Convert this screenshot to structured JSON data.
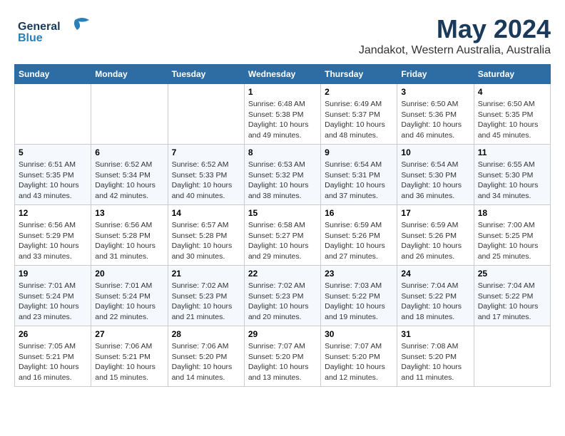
{
  "header": {
    "logo_line1": "General",
    "logo_line2": "Blue",
    "month_title": "May 2024",
    "location": "Jandakot, Western Australia, Australia"
  },
  "weekdays": [
    "Sunday",
    "Monday",
    "Tuesday",
    "Wednesday",
    "Thursday",
    "Friday",
    "Saturday"
  ],
  "weeks": [
    [
      {
        "day": "",
        "info": ""
      },
      {
        "day": "",
        "info": ""
      },
      {
        "day": "",
        "info": ""
      },
      {
        "day": "1",
        "info": "Sunrise: 6:48 AM\nSunset: 5:38 PM\nDaylight: 10 hours\nand 49 minutes."
      },
      {
        "day": "2",
        "info": "Sunrise: 6:49 AM\nSunset: 5:37 PM\nDaylight: 10 hours\nand 48 minutes."
      },
      {
        "day": "3",
        "info": "Sunrise: 6:50 AM\nSunset: 5:36 PM\nDaylight: 10 hours\nand 46 minutes."
      },
      {
        "day": "4",
        "info": "Sunrise: 6:50 AM\nSunset: 5:35 PM\nDaylight: 10 hours\nand 45 minutes."
      }
    ],
    [
      {
        "day": "5",
        "info": "Sunrise: 6:51 AM\nSunset: 5:35 PM\nDaylight: 10 hours\nand 43 minutes."
      },
      {
        "day": "6",
        "info": "Sunrise: 6:52 AM\nSunset: 5:34 PM\nDaylight: 10 hours\nand 42 minutes."
      },
      {
        "day": "7",
        "info": "Sunrise: 6:52 AM\nSunset: 5:33 PM\nDaylight: 10 hours\nand 40 minutes."
      },
      {
        "day": "8",
        "info": "Sunrise: 6:53 AM\nSunset: 5:32 PM\nDaylight: 10 hours\nand 38 minutes."
      },
      {
        "day": "9",
        "info": "Sunrise: 6:54 AM\nSunset: 5:31 PM\nDaylight: 10 hours\nand 37 minutes."
      },
      {
        "day": "10",
        "info": "Sunrise: 6:54 AM\nSunset: 5:30 PM\nDaylight: 10 hours\nand 36 minutes."
      },
      {
        "day": "11",
        "info": "Sunrise: 6:55 AM\nSunset: 5:30 PM\nDaylight: 10 hours\nand 34 minutes."
      }
    ],
    [
      {
        "day": "12",
        "info": "Sunrise: 6:56 AM\nSunset: 5:29 PM\nDaylight: 10 hours\nand 33 minutes."
      },
      {
        "day": "13",
        "info": "Sunrise: 6:56 AM\nSunset: 5:28 PM\nDaylight: 10 hours\nand 31 minutes."
      },
      {
        "day": "14",
        "info": "Sunrise: 6:57 AM\nSunset: 5:28 PM\nDaylight: 10 hours\nand 30 minutes."
      },
      {
        "day": "15",
        "info": "Sunrise: 6:58 AM\nSunset: 5:27 PM\nDaylight: 10 hours\nand 29 minutes."
      },
      {
        "day": "16",
        "info": "Sunrise: 6:59 AM\nSunset: 5:26 PM\nDaylight: 10 hours\nand 27 minutes."
      },
      {
        "day": "17",
        "info": "Sunrise: 6:59 AM\nSunset: 5:26 PM\nDaylight: 10 hours\nand 26 minutes."
      },
      {
        "day": "18",
        "info": "Sunrise: 7:00 AM\nSunset: 5:25 PM\nDaylight: 10 hours\nand 25 minutes."
      }
    ],
    [
      {
        "day": "19",
        "info": "Sunrise: 7:01 AM\nSunset: 5:24 PM\nDaylight: 10 hours\nand 23 minutes."
      },
      {
        "day": "20",
        "info": "Sunrise: 7:01 AM\nSunset: 5:24 PM\nDaylight: 10 hours\nand 22 minutes."
      },
      {
        "day": "21",
        "info": "Sunrise: 7:02 AM\nSunset: 5:23 PM\nDaylight: 10 hours\nand 21 minutes."
      },
      {
        "day": "22",
        "info": "Sunrise: 7:02 AM\nSunset: 5:23 PM\nDaylight: 10 hours\nand 20 minutes."
      },
      {
        "day": "23",
        "info": "Sunrise: 7:03 AM\nSunset: 5:22 PM\nDaylight: 10 hours\nand 19 minutes."
      },
      {
        "day": "24",
        "info": "Sunrise: 7:04 AM\nSunset: 5:22 PM\nDaylight: 10 hours\nand 18 minutes."
      },
      {
        "day": "25",
        "info": "Sunrise: 7:04 AM\nSunset: 5:22 PM\nDaylight: 10 hours\nand 17 minutes."
      }
    ],
    [
      {
        "day": "26",
        "info": "Sunrise: 7:05 AM\nSunset: 5:21 PM\nDaylight: 10 hours\nand 16 minutes."
      },
      {
        "day": "27",
        "info": "Sunrise: 7:06 AM\nSunset: 5:21 PM\nDaylight: 10 hours\nand 15 minutes."
      },
      {
        "day": "28",
        "info": "Sunrise: 7:06 AM\nSunset: 5:20 PM\nDaylight: 10 hours\nand 14 minutes."
      },
      {
        "day": "29",
        "info": "Sunrise: 7:07 AM\nSunset: 5:20 PM\nDaylight: 10 hours\nand 13 minutes."
      },
      {
        "day": "30",
        "info": "Sunrise: 7:07 AM\nSunset: 5:20 PM\nDaylight: 10 hours\nand 12 minutes."
      },
      {
        "day": "31",
        "info": "Sunrise: 7:08 AM\nSunset: 5:20 PM\nDaylight: 10 hours\nand 11 minutes."
      },
      {
        "day": "",
        "info": ""
      }
    ]
  ]
}
